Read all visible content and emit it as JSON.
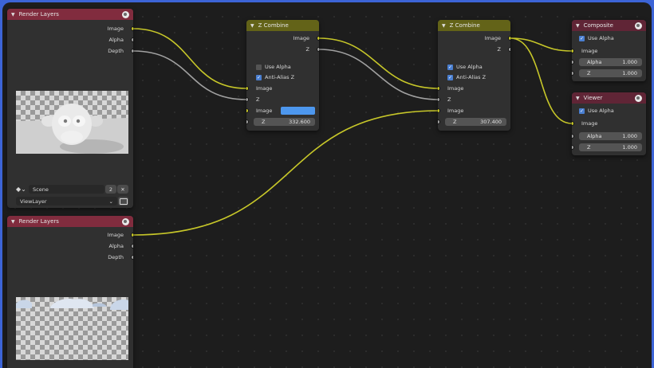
{
  "colors": {
    "color_socket": "#c7c729",
    "value_socket": "#a1a1a1",
    "render_layers_header": "#812c3e",
    "z_combine_header": "#636318",
    "output_header": "#602536",
    "checkbox_on": "#4a7fd1",
    "image_swatch": "#4d97ee"
  },
  "icons": {
    "collapse": "chevron-down-icon",
    "node_toggle": "globe-icon",
    "scene": "scene-icon",
    "close": "close-icon",
    "browse": "folder-icon",
    "checkbox_check": "✓"
  },
  "render_layers_1": {
    "title": "Render Layers",
    "outputs": [
      "Image",
      "Alpha",
      "Depth"
    ],
    "scene_name": "Scene",
    "scene_users": "2",
    "close_symbol": "✕",
    "view_layer": "ViewLayer",
    "dropdown_symbol": "⌄"
  },
  "render_layers_2": {
    "title": "Render Layers",
    "outputs": [
      "Image",
      "Alpha",
      "Depth"
    ]
  },
  "z_combine_1": {
    "title": "Z Combine",
    "out_image": "Image",
    "out_z": "Z",
    "use_alpha": {
      "label": "Use Alpha",
      "checked": false
    },
    "anti_alias_z": {
      "label": "Anti-Alias Z",
      "checked": true
    },
    "in_image_1": "Image",
    "in_z_1": "Z",
    "in_image_2": "Image",
    "z_field": {
      "label": "Z",
      "value": "332.600"
    }
  },
  "z_combine_2": {
    "title": "Z Combine",
    "out_image": "Image",
    "out_z": "Z",
    "use_alpha": {
      "label": "Use Alpha",
      "checked": true
    },
    "anti_alias_z": {
      "label": "Anti-Alias Z",
      "checked": true
    },
    "in_image_1": "Image",
    "in_z_1": "Z",
    "in_image_2": "Image",
    "z_field": {
      "label": "Z",
      "value": "307.400"
    }
  },
  "composite": {
    "title": "Composite",
    "use_alpha": {
      "label": "Use Alpha",
      "checked": true
    },
    "in_image": "Image",
    "alpha_field": {
      "label": "Alpha",
      "value": "1.000"
    },
    "z_field": {
      "label": "Z",
      "value": "1.000"
    }
  },
  "viewer": {
    "title": "Viewer",
    "use_alpha": {
      "label": "Use Alpha",
      "checked": true
    },
    "in_image": "Image",
    "alpha_field": {
      "label": "Alpha",
      "value": "1.000"
    },
    "z_field": {
      "label": "Z",
      "value": "1.000"
    }
  }
}
